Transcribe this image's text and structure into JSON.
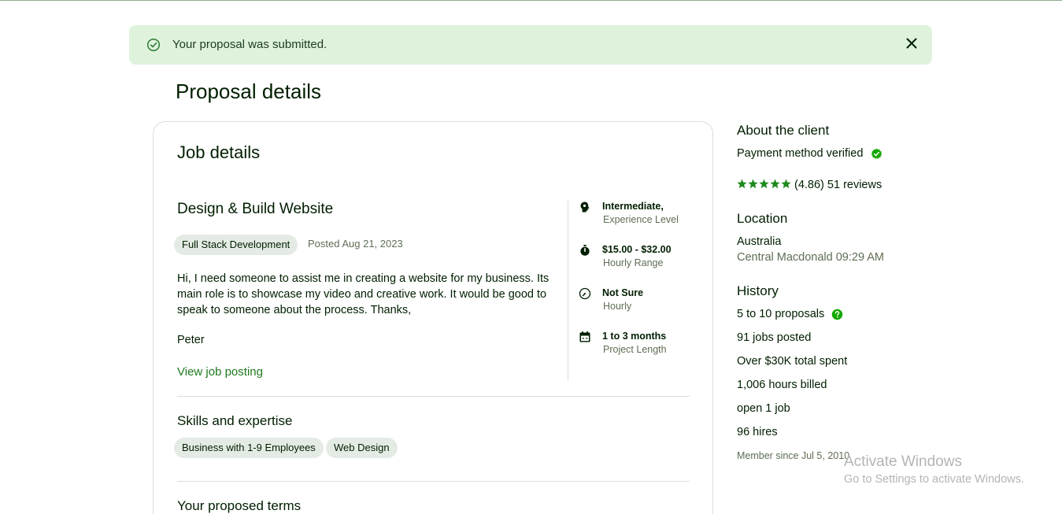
{
  "banner": {
    "message": "Your proposal was submitted.",
    "icon": "check-circle-icon",
    "close_icon": "close-icon"
  },
  "page": {
    "title": "Proposal details"
  },
  "job_card": {
    "title": "Job details",
    "job_title": "Design & Build Website",
    "category": "Full Stack Development",
    "posted": "Posted Aug 21, 2023",
    "description": "Hi, I need someone to assist me in creating a website for my business. Its main role is to showcase my video and creative work. It would be good to speak to someone about the process. Thanks,",
    "signature": "Peter",
    "view_link": "View job posting",
    "meta": [
      {
        "icon": "brain-icon",
        "value": "Intermediate,",
        "label": "Experience Level"
      },
      {
        "icon": "stopwatch-icon",
        "value": "$15.00 - $32.00",
        "label": "Hourly Range"
      },
      {
        "icon": "clock-icon",
        "value": "Not Sure",
        "label": "Hourly"
      },
      {
        "icon": "calendar-icon",
        "value": "1 to 3 months",
        "label": "Project Length"
      }
    ],
    "skills_title": "Skills and expertise",
    "skills": [
      "Business with 1-9 Employees",
      "Web Design"
    ],
    "terms_title": "Your proposed terms"
  },
  "client": {
    "about_title": "About the client",
    "payment": "Payment method verified",
    "rating": "(4.86) 51 reviews",
    "stars": 5,
    "location_title": "Location",
    "country": "Australia",
    "city_time": "Central Macdonald 09:29 AM",
    "history_title": "History",
    "proposals": "5 to 10 proposals",
    "jobs_posted": "91 jobs posted",
    "total_spent": "Over $30K total spent",
    "hours_billed": "1,006 hours billed",
    "open_jobs": "open 1 job",
    "hires": "96 hires",
    "member_since": "Member since Jul 5, 2010"
  },
  "watermark": {
    "line1": "Activate Windows",
    "line2": "Go to Settings to activate Windows."
  },
  "colors": {
    "banner_bg": "#dff3dc",
    "accent_green": "#1f7a1f",
    "verified_green": "#14a800",
    "chip_bg": "#e4ebe4"
  }
}
